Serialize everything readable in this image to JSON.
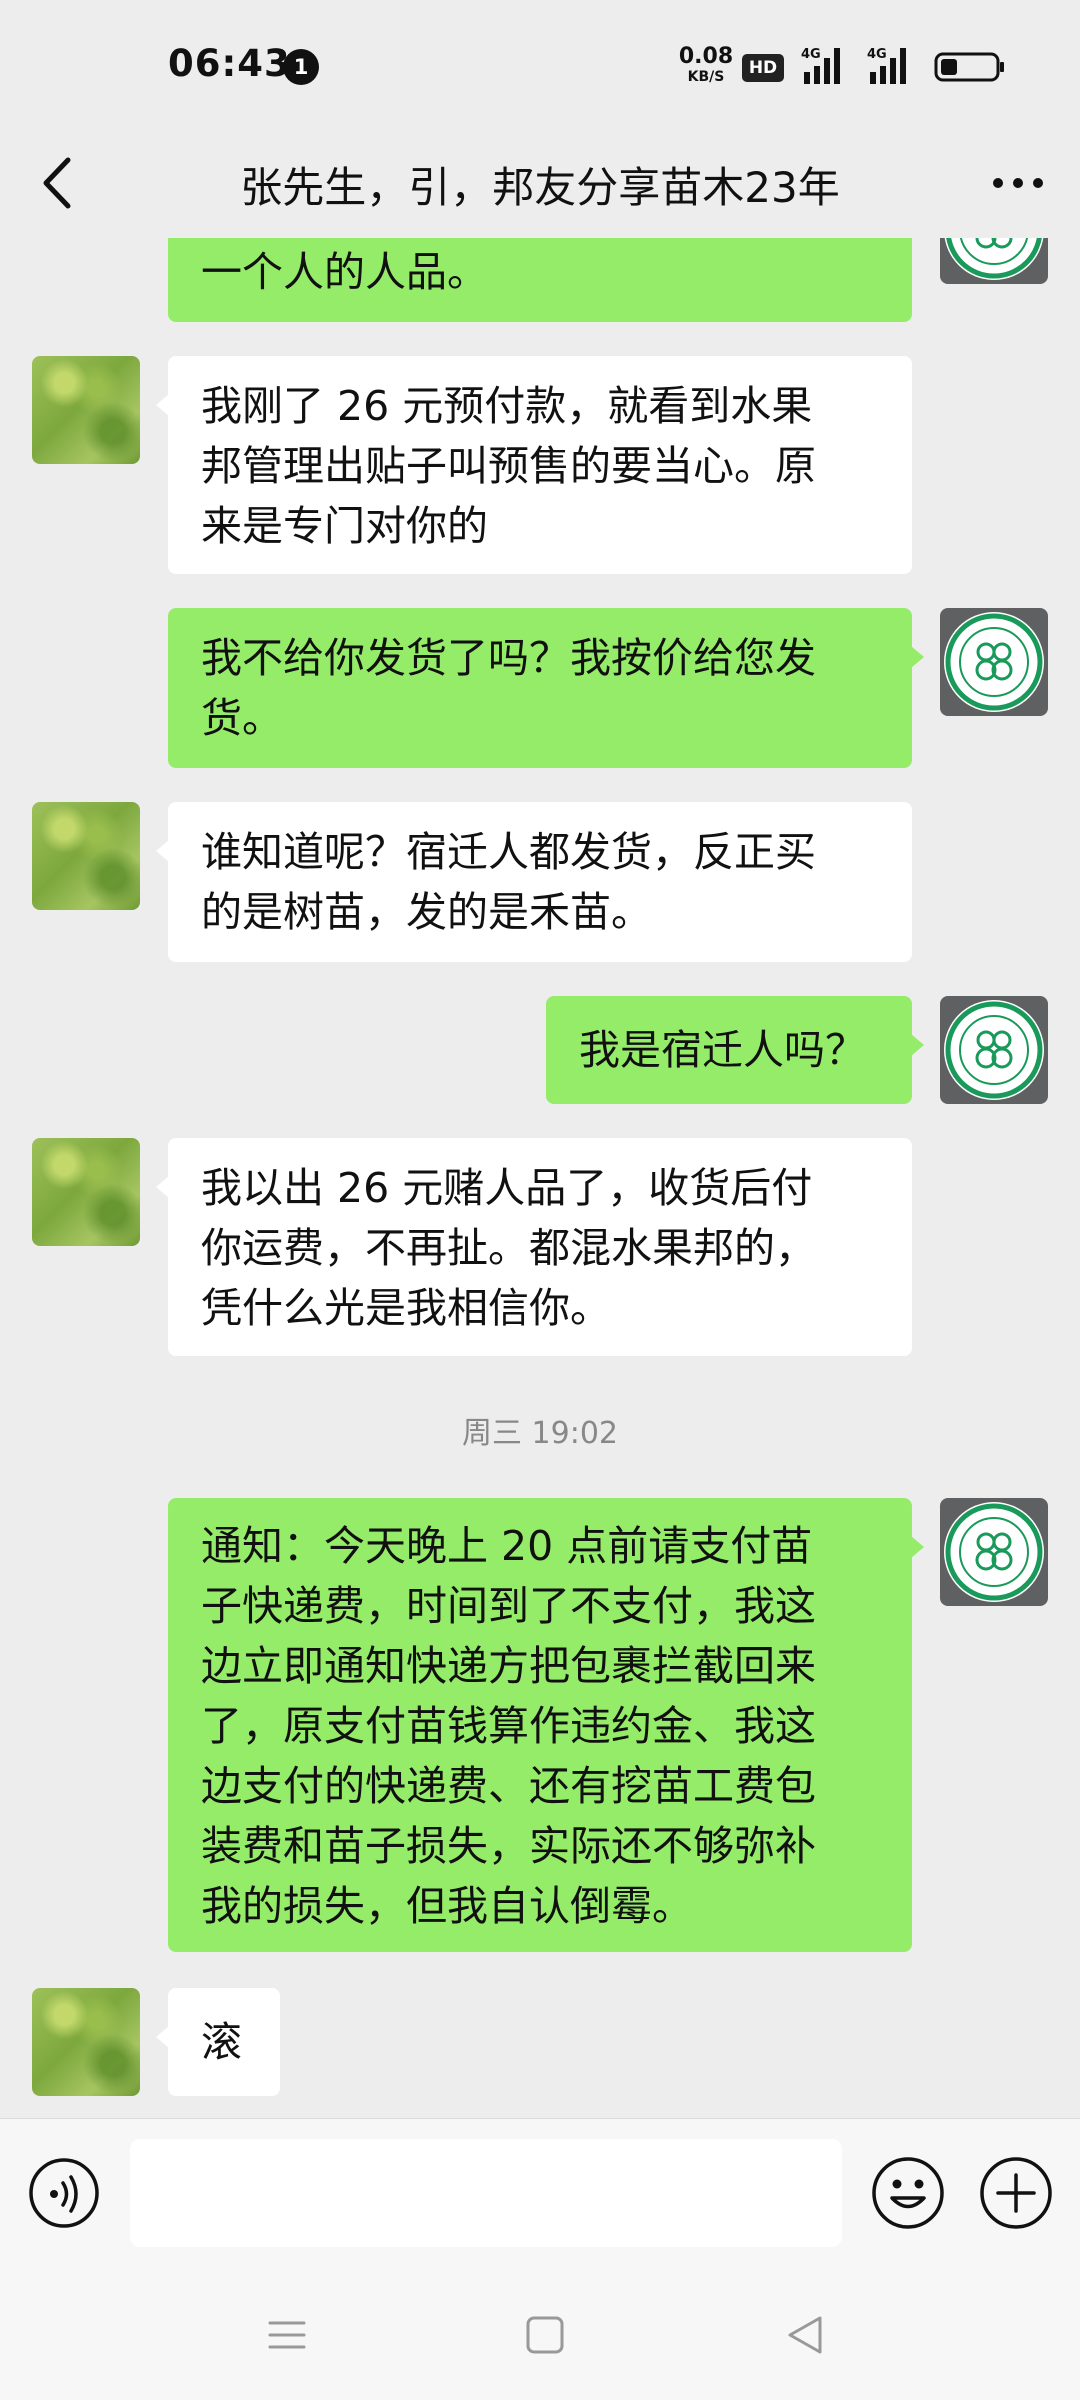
{
  "status_bar": {
    "time": "06:43",
    "notification_count": "1",
    "net_speed_value": "0.08",
    "net_speed_unit": "KB/S",
    "hd_badge": "HD",
    "signal_1": "4G",
    "signal_2": "4G",
    "battery_level": 0.3
  },
  "header": {
    "title": "张先生，引，邦友分享苗木23年",
    "back_icon": "chevron-left-icon",
    "more_icon": "more-dots-icon"
  },
  "messages": [
    {
      "sender": "me",
      "text": "一个人的人品。"
    },
    {
      "sender": "other",
      "text": "我刚了 26 元预付款，就看到水果邦管理出贴子叫预售的要当心。原来是专门对你的"
    },
    {
      "sender": "me",
      "text": "我不给你发货了吗？我按价给您发货。"
    },
    {
      "sender": "other",
      "text": "谁知道呢？宿迁人都发货，反正买的是树苗，发的是禾苗。"
    },
    {
      "sender": "me",
      "text": "我是宿迁人吗？"
    },
    {
      "sender": "other",
      "text": "我以出 26 元赌人品了，收货后付你运费，不再扯。都混水果邦的，凭什么光是我相信你。"
    },
    {
      "type": "timestamp",
      "text": "周三 19:02"
    },
    {
      "sender": "me",
      "text": "通知：今天晚上 20 点前请支付苗子快递费，时间到了不支付，我这边立即通知快递方把包裹拦截回来了，原支付苗钱算作违约金、我这边支付的快递费、还有挖苗工费包装费和苗子损失，实际还不够弥补我的损失，但我自认倒霉。"
    },
    {
      "sender": "other",
      "text": "滚"
    }
  ],
  "bubble_lines": {
    "m0": [
      "一个人的人品。"
    ],
    "m1": [
      "我刚了 26 元预付款，就看到水果",
      "邦管理出贴子叫预售的要当心。原",
      "来是专门对你的"
    ],
    "m2": [
      "我不给你发货了吗？我按价给您发",
      "货。"
    ],
    "m3": [
      "谁知道呢？宿迁人都发货，反正买",
      "的是树苗，发的是禾苗。"
    ],
    "m4": [
      "我是宿迁人吗？"
    ],
    "m5": [
      "我以出 26 元赌人品了，收货后付",
      "你运费，不再扯。都混水果邦的，",
      "凭什么光是我相信你。"
    ],
    "m7": [
      "通知：今天晚上 20 点前请支付苗",
      "子快递费，时间到了不支付，我这",
      "边立即通知快递方把包裹拦截回来",
      "了，原支付苗钱算作违约金、我这",
      "边支付的快递费、还有挖苗工费包",
      "装费和苗子损失，实际还不够弥补",
      "我的损失，但我自认倒霉。"
    ],
    "m8": [
      "滚"
    ]
  },
  "input_bar": {
    "message_value": "",
    "voice_icon": "voice-icon",
    "emoji_icon": "emoji-icon",
    "plus_icon": "plus-icon"
  },
  "nav_bar": {
    "menu_icon": "menu-icon",
    "home_icon": "home-square-icon",
    "back_icon": "back-triangle-icon"
  },
  "colors": {
    "background": "#ededed",
    "bubble_me": "#95ec69",
    "bubble_other": "#ffffff",
    "timestamp": "#888888",
    "self_avatar_ring": "#1a9a5a"
  }
}
